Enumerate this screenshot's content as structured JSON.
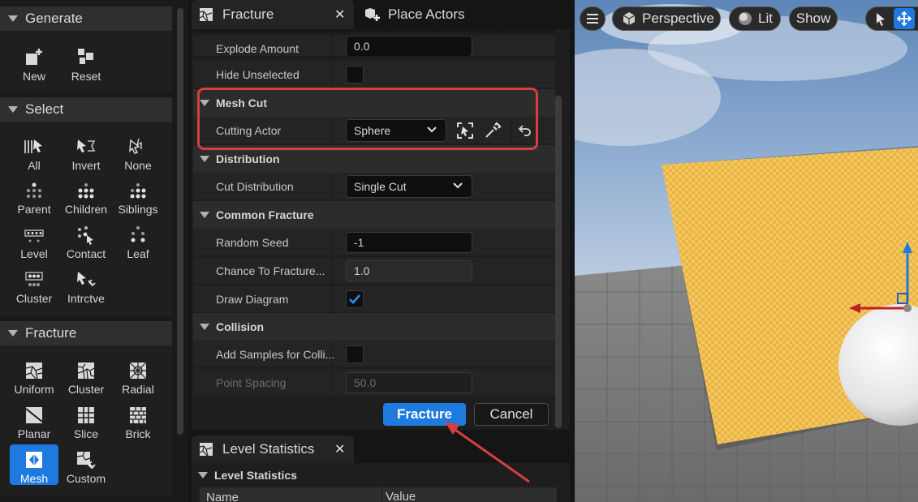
{
  "left_panel": {
    "generate": {
      "title": "Generate",
      "tools": [
        {
          "label": "New",
          "icon": "new-icon"
        },
        {
          "label": "Reset",
          "icon": "reset-icon"
        }
      ]
    },
    "select": {
      "title": "Select",
      "tools": [
        {
          "label": "All",
          "icon": "select-all-icon"
        },
        {
          "label": "Invert",
          "icon": "invert-icon"
        },
        {
          "label": "None",
          "icon": "select-none-icon"
        },
        {
          "label": "Parent",
          "icon": "parent-icon"
        },
        {
          "label": "Children",
          "icon": "children-icon"
        },
        {
          "label": "Siblings",
          "icon": "siblings-icon"
        },
        {
          "label": "Level",
          "icon": "level-icon"
        },
        {
          "label": "Contact",
          "icon": "contact-icon"
        },
        {
          "label": "Leaf",
          "icon": "leaf-icon"
        },
        {
          "label": "Cluster",
          "icon": "cluster-icon"
        },
        {
          "label": "Intrctve",
          "icon": "interactive-icon"
        }
      ]
    },
    "fracture": {
      "title": "Fracture",
      "tools": [
        {
          "label": "Uniform",
          "icon": "uniform-icon"
        },
        {
          "label": "Cluster",
          "icon": "cluster-fracture-icon"
        },
        {
          "label": "Radial",
          "icon": "radial-icon"
        },
        {
          "label": "Planar",
          "icon": "planar-icon"
        },
        {
          "label": "Slice",
          "icon": "slice-icon"
        },
        {
          "label": "Brick",
          "icon": "brick-icon"
        },
        {
          "label": "Mesh",
          "icon": "mesh-icon"
        },
        {
          "label": "Custom",
          "icon": "custom-icon"
        }
      ],
      "selected": "Mesh"
    }
  },
  "tabs": {
    "fracture": "Fracture",
    "place_actors": "Place Actors",
    "level_statistics": "Level Statistics"
  },
  "properties": {
    "explode_amount": {
      "label": "Explode Amount",
      "value": "0.0"
    },
    "hide_unselected": {
      "label": "Hide Unselected",
      "checked": false
    },
    "mesh_cut": {
      "title": "Mesh Cut"
    },
    "cutting_actor": {
      "label": "Cutting Actor",
      "value": "Sphere"
    },
    "distribution": {
      "title": "Distribution"
    },
    "cut_distribution": {
      "label": "Cut Distribution",
      "value": "Single Cut"
    },
    "common_fracture": {
      "title": "Common Fracture"
    },
    "random_seed": {
      "label": "Random Seed",
      "value": "-1"
    },
    "chance_to_fracture": {
      "label": "Chance To Fracture...",
      "value": "1.0"
    },
    "draw_diagram": {
      "label": "Draw Diagram",
      "checked": true
    },
    "collision": {
      "title": "Collision"
    },
    "add_samples": {
      "label": "Add Samples for Colli...",
      "checked": false
    },
    "point_spacing": {
      "label": "Point Spacing",
      "value": "50.0"
    }
  },
  "actions": {
    "fracture": "Fracture",
    "cancel": "Cancel"
  },
  "level_stats": {
    "category": "Level Statistics",
    "columns": [
      "Name",
      "Value"
    ]
  },
  "viewport": {
    "perspective": "Perspective",
    "lit": "Lit",
    "show": "Show"
  },
  "colors": {
    "accent": "#1f7ae0",
    "highlight": "#d43f3f"
  }
}
